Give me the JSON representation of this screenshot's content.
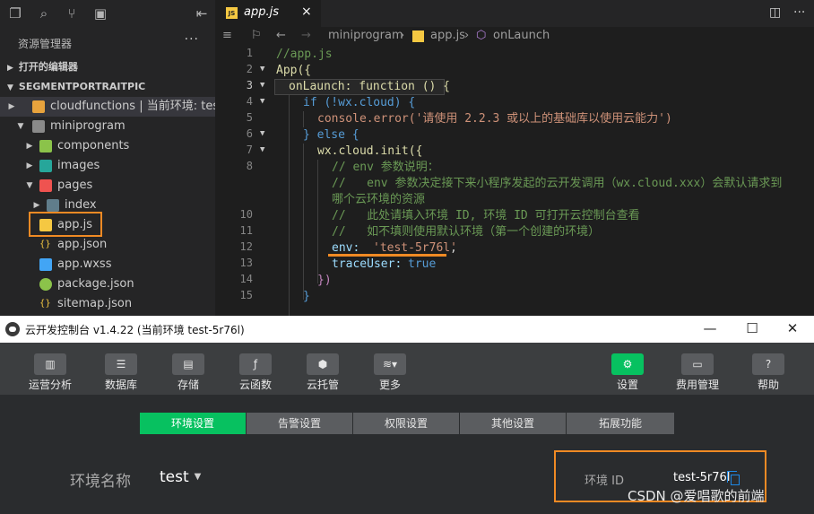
{
  "sidebar": {
    "title": "资源管理器",
    "more": "···",
    "open_editors": "打开的编辑器",
    "project": "SEGMENTPORTRAITPIC",
    "tree": [
      {
        "label": "cloudfunctions | 当前环境: test",
        "color": "#e8a33d"
      },
      {
        "label": "miniprogram",
        "color": "#8a8a8a"
      },
      {
        "label": "components",
        "color": "#8bc34a"
      },
      {
        "label": "images",
        "color": "#26a69a"
      },
      {
        "label": "pages",
        "color": "#ef5350"
      },
      {
        "label": "index",
        "color": "#607d8b"
      },
      {
        "label": "app.js",
        "color": "#f5c842"
      },
      {
        "label": "app.json",
        "color": "#f5c842"
      },
      {
        "label": "app.wxss",
        "color": "#42a5f5"
      },
      {
        "label": "package.json",
        "color": "#8bc34a"
      },
      {
        "label": "sitemap.json",
        "color": "#f5c842"
      }
    ]
  },
  "editor": {
    "tab": {
      "label": "app.js",
      "close": "×"
    },
    "breadcrumb": [
      "miniprogram",
      "app.js",
      "onLaunch"
    ],
    "line_numbers": [
      "1",
      "2",
      "3",
      "4",
      "5",
      "6",
      "7",
      "8",
      "",
      "10",
      "11",
      "12",
      "13",
      "14",
      "15"
    ],
    "lines": [
      "//app.js",
      "App({",
      "onLaunch: function () {",
      "if (!wx.cloud) {",
      "console.error('请使用 2.2.3 或以上的基础库以使用云能力')",
      "} else {",
      "wx.cloud.init({",
      "// env 参数说明：",
      "//   env 参数决定接下来小程序发起的云开发调用（wx.cloud.xxx）会默认请求到",
      "哪个云环境的资源",
      "//   此处请填入环境 ID, 环境 ID 可打开云控制台查看",
      "//   如不填则使用默认环境（第一个创建的环境）",
      "env: ",
      "'test-5r76l'",
      ",",
      "traceUser: ",
      "true",
      "})",
      "}"
    ]
  },
  "console": {
    "title": "云开发控制台 v1.4.22 (当前环境 test-5r76l)",
    "window": {
      "minimize": "—",
      "maximize": "☐",
      "close": "✕"
    },
    "toolbar": [
      {
        "label": "运营分析",
        "icon": "chart-icon"
      },
      {
        "label": "数据库",
        "icon": "database-icon"
      },
      {
        "label": "存储",
        "icon": "storage-icon"
      },
      {
        "label": "云函数",
        "icon": "function-icon"
      },
      {
        "label": "云托管",
        "icon": "cube-icon"
      },
      {
        "label": "更多",
        "icon": "layers-icon"
      },
      {
        "label": "设置",
        "icon": "gear-icon"
      },
      {
        "label": "费用管理",
        "icon": "billing-icon"
      },
      {
        "label": "帮助",
        "icon": "help-icon"
      }
    ],
    "tabs": [
      "环境设置",
      "告警设置",
      "权限设置",
      "其他设置",
      "拓展功能"
    ],
    "env_name_label": "环境名称",
    "env_name_value": "test",
    "env_id_label": "环境 ID",
    "env_id_value": "test-5r76l"
  },
  "watermark": "CSDN @爱唱歌的前端",
  "colors": {
    "accent": "#07c160",
    "highlight": "#f08a24"
  }
}
